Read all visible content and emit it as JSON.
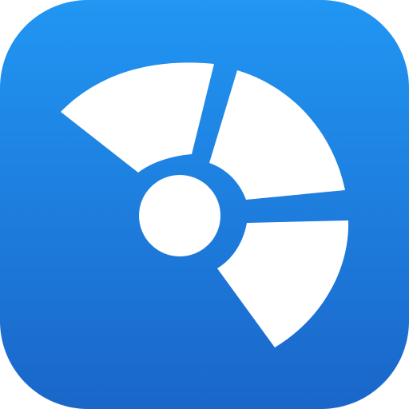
{
  "app_icon": {
    "icon": "disc-segments-icon",
    "colors": {
      "gradient_top": "#2196F3",
      "gradient_bottom": "#1A66C9",
      "glyph": "#FFFFFF"
    }
  }
}
